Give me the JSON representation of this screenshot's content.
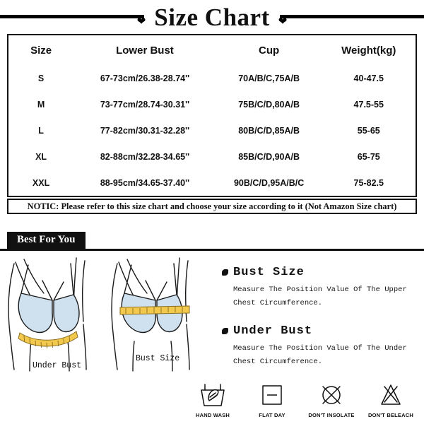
{
  "title": {
    "text": "Size Chart",
    "ornament": "heart"
  },
  "table": {
    "headers": [
      "Size",
      "Lower Bust",
      "Cup",
      "Weight(kg)"
    ],
    "rows": [
      [
        "S",
        "67-73cm/26.38-28.74''",
        "70A/B/C,75A/B",
        "40-47.5"
      ],
      [
        "M",
        "73-77cm/28.74-30.31''",
        "75B/C/D,80A/B",
        "47.5-55"
      ],
      [
        "L",
        "77-82cm/30.31-32.28''",
        "80B/C/D,85A/B",
        "55-65"
      ],
      [
        "XL",
        "82-88cm/32.28-34.65''",
        "85B/C/D,90A/B",
        "65-75"
      ],
      [
        "XXL",
        "88-95cm/34.65-37.40''",
        "90B/C/D,95A/B/C",
        "75-82.5"
      ]
    ]
  },
  "notice": "NOTIC: Please refer to this size chart and choose your size according to it (Not Amazon Size chart)",
  "section": {
    "best_for_you": "Best For You"
  },
  "illustrations": {
    "left_label": "Under Bust",
    "right_label": "Bust Size",
    "cup_color": "#cfe0ee",
    "tape_color": "#f2c94c",
    "outline_color": "#1a1a1a"
  },
  "instructions": [
    {
      "title": "Bust Size",
      "line1": "Measure The Position Value Of The Upper",
      "line2": "Chest Circumference."
    },
    {
      "title": "Under Bust",
      "line1": "Measure The Position Value Of The Under",
      "line2": "Chest Circumference."
    }
  ],
  "care_icons": [
    {
      "label": "HAND WASH",
      "icon": "hand-wash-icon"
    },
    {
      "label": "FLAT DAY",
      "icon": "flat-dry-icon"
    },
    {
      "label": "DON'T INSOLATE",
      "icon": "no-tumble-dry-icon"
    },
    {
      "label": "DON'T BELEACH",
      "icon": "no-bleach-icon"
    }
  ]
}
